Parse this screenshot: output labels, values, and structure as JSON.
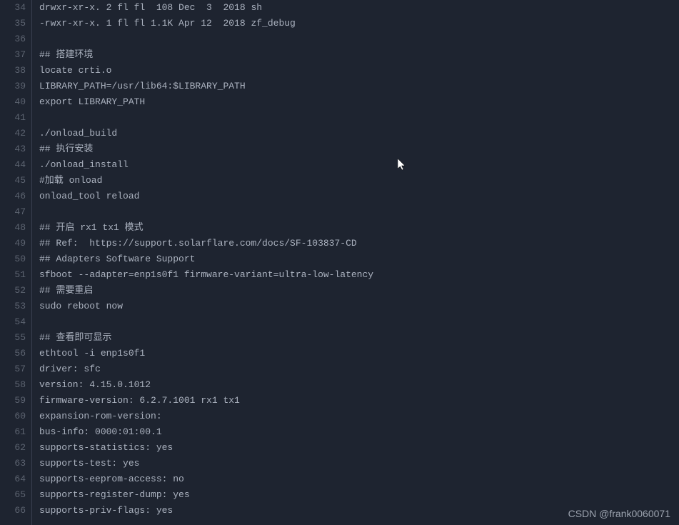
{
  "lines": [
    {
      "num": 34,
      "text": "drwxr-xr-x. 2 fl fl  108 Dec  3  2018 sh"
    },
    {
      "num": 35,
      "text": "-rwxr-xr-x. 1 fl fl 1.1K Apr 12  2018 zf_debug"
    },
    {
      "num": 36,
      "text": ""
    },
    {
      "num": 37,
      "text": "## 搭建环境"
    },
    {
      "num": 38,
      "text": "locate crti.o"
    },
    {
      "num": 39,
      "text": "LIBRARY_PATH=/usr/lib64:$LIBRARY_PATH"
    },
    {
      "num": 40,
      "text": "export LIBRARY_PATH"
    },
    {
      "num": 41,
      "text": ""
    },
    {
      "num": 42,
      "text": "./onload_build"
    },
    {
      "num": 43,
      "text": "## 执行安装"
    },
    {
      "num": 44,
      "text": "./onload_install"
    },
    {
      "num": 45,
      "text": "#加载 onload"
    },
    {
      "num": 46,
      "text": "onload_tool reload"
    },
    {
      "num": 47,
      "text": ""
    },
    {
      "num": 48,
      "text": "## 开启 rx1 tx1 模式"
    },
    {
      "num": 49,
      "text": "## Ref:  https://support.solarflare.com/docs/SF-103837-CD"
    },
    {
      "num": 50,
      "text": "## Adapters Software Support"
    },
    {
      "num": 51,
      "text": "sfboot --adapter=enp1s0f1 firmware-variant=ultra-low-latency"
    },
    {
      "num": 52,
      "text": "## 需要重启"
    },
    {
      "num": 53,
      "text": "sudo reboot now"
    },
    {
      "num": 54,
      "text": ""
    },
    {
      "num": 55,
      "text": "## 查看即可显示"
    },
    {
      "num": 56,
      "text": "ethtool -i enp1s0f1"
    },
    {
      "num": 57,
      "text": "driver: sfc"
    },
    {
      "num": 58,
      "text": "version: 4.15.0.1012"
    },
    {
      "num": 59,
      "text": "firmware-version: 6.2.7.1001 rx1 tx1"
    },
    {
      "num": 60,
      "text": "expansion-rom-version:"
    },
    {
      "num": 61,
      "text": "bus-info: 0000:01:00.1"
    },
    {
      "num": 62,
      "text": "supports-statistics: yes"
    },
    {
      "num": 63,
      "text": "supports-test: yes"
    },
    {
      "num": 64,
      "text": "supports-eeprom-access: no"
    },
    {
      "num": 65,
      "text": "supports-register-dump: yes"
    },
    {
      "num": 66,
      "text": "supports-priv-flags: yes"
    }
  ],
  "watermark": "CSDN @frank0060071"
}
